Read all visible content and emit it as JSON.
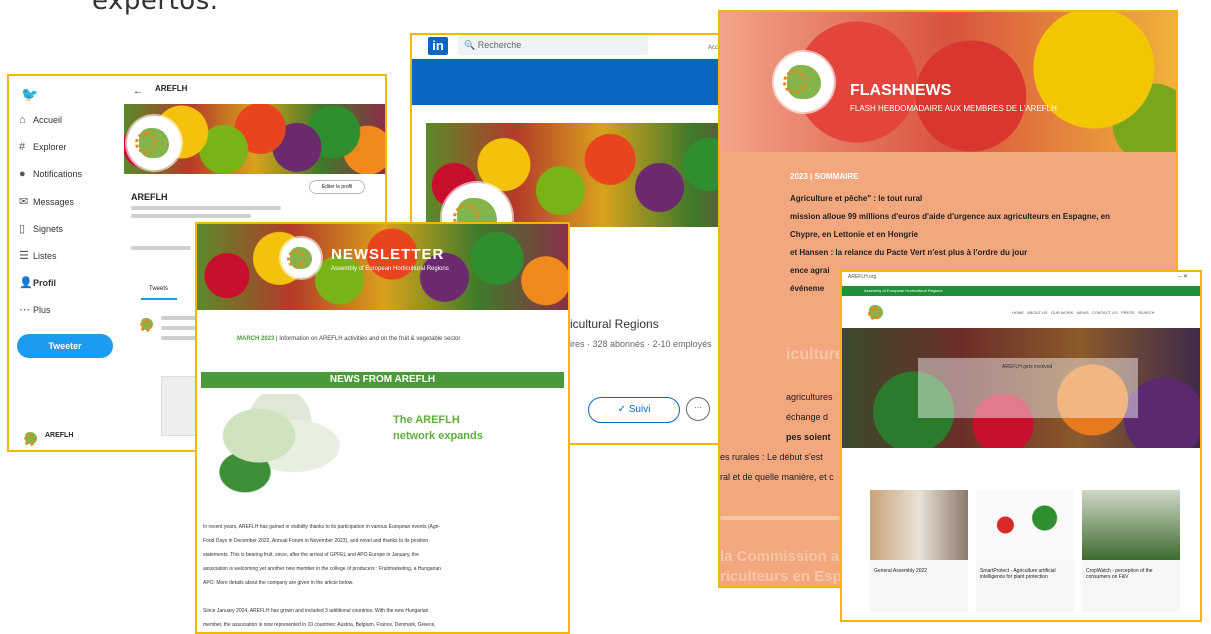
{
  "caption": "expertos.",
  "twitter": {
    "nav": [
      "Accueil",
      "Explorer",
      "Notifications",
      "Messages",
      "Signets",
      "Listes",
      "Profil",
      "Plus"
    ],
    "tweet_button": "Tweeter",
    "profile_name": "AREFLH",
    "edit_profile": "Éditer le profil",
    "tab_tweets": "Tweets",
    "account_label": "AREFLH"
  },
  "linkedin": {
    "logo": "in",
    "search_placeholder": "Recherche",
    "home_label": "Accueil",
    "org_text": "icultural Regions",
    "meta": "ires · 328 abonnés · 2-10 employés",
    "follow_button": "✓ Suivi",
    "more_button": "···"
  },
  "flash": {
    "title": "FLASHNEWS",
    "subtitle": "FLASH HEBDOMADAIRE AUX MEMBRES DE L'AREFLH",
    "summary_head": "2023 | SOMMAIRE",
    "items": [
      "Agriculture et pêche\" : le tout rural",
      "mission alloue 99 millions d'euros d'aide d'urgence aux agriculteurs en Espagne, en",
      "Chypre, en Lettonie et en Hongrie",
      "et Hansen : la relance du Pacte Vert n'est plus à l'ordre du jour",
      "ence agrai",
      "événeme"
    ],
    "section": "iculture",
    "frag1": "agricultures",
    "frag2": "échange d",
    "frag3": "pes soient",
    "frag4": "es rurales : Le début s'est",
    "frag5": "ral et de quelle manière, et c",
    "frag6": "la Commission alloue",
    "frag7": "riculteurs en Espa"
  },
  "website": {
    "title_bar": "AREFLH.org",
    "green_text": "Assembly of European Horticultural Regions",
    "menu": [
      "HOME",
      "ABOUT US",
      "OUR WORK",
      "NEWS",
      "CONTACT US",
      "PRESS",
      "SEARCH"
    ],
    "hero_title": "AREFLH gets involved",
    "cards": [
      "General Assembly 2022",
      "SmartProtect - Agriculture artificial intelligence for plant protection",
      "CropWatch - perception of the consumers on F&V"
    ]
  },
  "newsletter": {
    "title": "NEWSLETTER",
    "subtitle": "Assembly of European Horticultural Regions",
    "intro_date": "MARCH 2023",
    "intro_text": " | Information on AREFLH activities and on the fruit & vegetable sector",
    "section": "NEWS FROM AREFLH",
    "headline_1": "The AREFLH",
    "headline_2": "network expands",
    "para1": [
      "In recent years, AREFLH has gained in visibility thanks to its participation in various European events (Agri-",
      "Food Days in December 2022, Annual Forum in November 2023), and novel and thanks to its position",
      "statements. This is bearing fruit, since, after the arrival of GPFEL and APO Europe in January, the",
      "association is welcoming yet another new member in the college of producers : Fruitmarketing, a Hungarian",
      "APO. More details about the company are given in the article below."
    ],
    "para2": [
      "Since January 2024, AREFLH has grown and included 3 additional countries. With the new Hungarian",
      "member, the association is now represented in 10 countries: Austria, Belgium, France, Denmark, Greece,"
    ]
  },
  "colors": {
    "frame": "#f2b705",
    "twitter_blue": "#1d9bf0",
    "linkedin_blue": "#0a66c2",
    "newsletter_green": "#4a9a3a",
    "flash_orange": "#f2a77f"
  }
}
